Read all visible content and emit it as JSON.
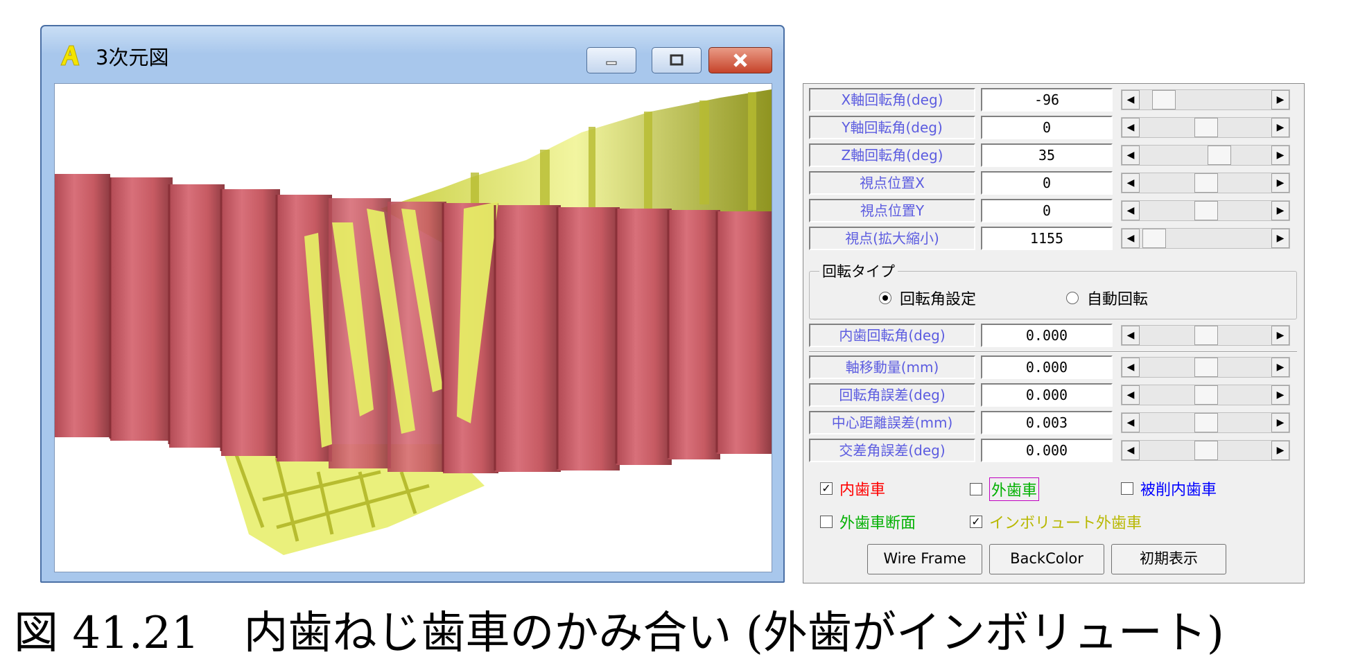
{
  "window": {
    "title": "3次元図",
    "icon": "app-logo-icon",
    "buttons": [
      "minimize-icon",
      "maximize-icon",
      "close-icon"
    ]
  },
  "panel": {
    "rows": [
      {
        "label": "X軸回転角(deg)",
        "value": "-96",
        "slider": 0.12
      },
      {
        "label": "Y軸回転角(deg)",
        "value": "0",
        "slider": 0.5
      },
      {
        "label": "Z軸回転角(deg)",
        "value": "35",
        "slider": 0.6
      },
      {
        "label": "視点位置X",
        "value": "0",
        "slider": 0.5
      },
      {
        "label": "視点位置Y",
        "value": "0",
        "slider": 0.5
      },
      {
        "label": "視点(拡大縮小)",
        "value": "1155",
        "slider": 0.06
      }
    ],
    "rotation_type": {
      "title": "回転タイプ",
      "options": [
        "回転角設定",
        "自動回転"
      ],
      "selected": 0
    },
    "internal_rotation": {
      "label": "内歯回転角(deg)",
      "value": "0.000",
      "slider": 0.5
    },
    "error_rows": [
      {
        "label": "軸移動量(mm)",
        "value": "0.000",
        "slider": 0.5
      },
      {
        "label": "回転角誤差(deg)",
        "value": "0.000",
        "slider": 0.5
      },
      {
        "label": "中心距離誤差(mm)",
        "value": "0.003",
        "slider": 0.5
      },
      {
        "label": "交差角誤差(deg)",
        "value": "0.000",
        "slider": 0.5
      }
    ],
    "checkboxes": [
      {
        "label": "内歯車",
        "checked": true,
        "color": "#ff0000"
      },
      {
        "label": "外歯車",
        "checked": false,
        "color": "#00b000"
      },
      {
        "label": "被削内歯車",
        "checked": false,
        "color": "#0000ff"
      },
      {
        "label": "外歯車断面",
        "checked": false,
        "color": "#00b000"
      },
      {
        "label": "インボリュート外歯車",
        "checked": true,
        "color": "#b8b800"
      }
    ],
    "buttons": [
      "Wire Frame",
      "BackColor",
      "初期表示"
    ]
  },
  "caption": "図 41.21　内歯ねじ歯車のかみ合い (外歯がインボリュート)",
  "colors": {
    "internal_gear": "#c65a62",
    "involute_gear": "#e8ec7a"
  }
}
